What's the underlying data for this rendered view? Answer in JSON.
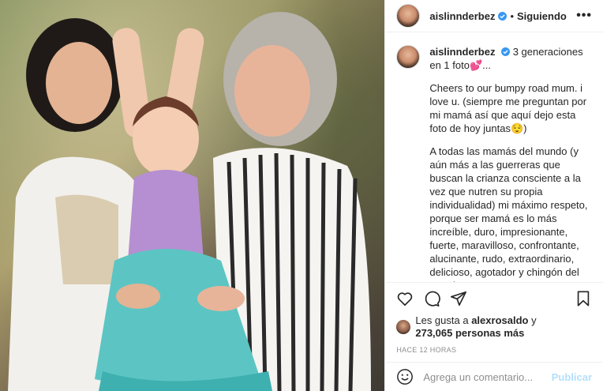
{
  "header": {
    "username": "aislinnderbez",
    "separator": "•",
    "follow_status": "Siguiendo",
    "more": "•••"
  },
  "caption": {
    "username": "aislinnderbez",
    "first_line": "3 generaciones en 1 foto💕...",
    "paragraphs": [
      "Cheers to our bumpy road mum. i love u. (siempre me preguntan por mi mamá así que aquí dejo esta foto de hoy juntas😌)",
      "A todas las mamás del mundo (y aún más a las guerreras que buscan la crianza consciente a la vez que nutren su propia individualidad) mi máximo respeto, porque ser mamá es lo más increíble, duro, impresionante, fuerte, maravilloso, confrontante, alucinante, rudo, extraordinario, delicioso, agotador y chingón del mundo.."
    ]
  },
  "actions": {
    "icons": [
      "heart-icon",
      "comment-icon",
      "share-icon",
      "bookmark-icon"
    ]
  },
  "likes": {
    "prefix": "Les gusta a",
    "liker": "alexrosaldo",
    "conj": "y",
    "count": "273,065 personas más"
  },
  "timestamp": "HACE 12 HORAS",
  "comment_box": {
    "placeholder": "Agrega un comentario...",
    "publish": "Publicar"
  },
  "colors": {
    "verified": "#3897f0",
    "link_disabled": "#b2dffc",
    "muted": "#8e8e8e"
  }
}
